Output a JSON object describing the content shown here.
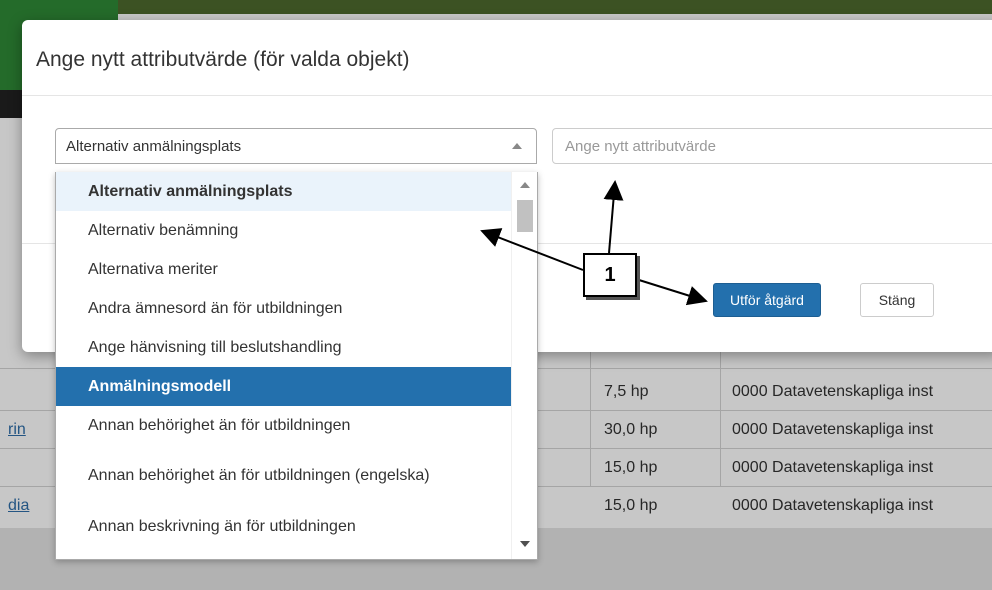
{
  "background": {
    "rows": [
      {
        "link": "",
        "credits": "7,5 hp",
        "org": "0000 Datavetenskapliga inst"
      },
      {
        "link": "rin",
        "credits": "30,0 hp",
        "org": "0000 Datavetenskapliga inst"
      },
      {
        "link": "",
        "credits": "15,0 hp",
        "org": "0000 Datavetenskapliga inst"
      },
      {
        "link": "dia",
        "credits": "15,0 hp",
        "org": "0000 Datavetenskapliga inst"
      }
    ]
  },
  "modal": {
    "title": "Ange nytt attributvärde (för valda objekt)",
    "select_value": "Alternativ anmälningsplats",
    "input_placeholder": "Ange nytt attributvärde",
    "execute_label": "Utför åtgärd",
    "close_label": "Stäng"
  },
  "dropdown": {
    "items": [
      "Alternativ anmälningsplats",
      "Alternativ benämning",
      "Alternativa meriter",
      "Andra ämnesord än för utbildningen",
      "Ange hänvisning till beslutshandling",
      "Anmälningsmodell",
      "Annan behörighet än för utbildningen",
      "Annan behörighet än för utbildningen (engelska)",
      "Annan beskrivning än för utbildningen"
    ],
    "selected": "Anmälningsmodell",
    "highlighted": "Alternativ anmälningsplats"
  },
  "annotation": {
    "callout_number": "1"
  },
  "colors": {
    "primary": "#2370ad",
    "highlight": "#eaf3fb",
    "overlay": "#dcdcdc"
  }
}
